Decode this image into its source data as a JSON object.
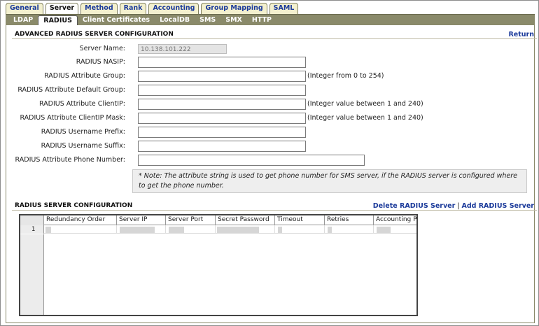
{
  "top_tabs": [
    "General",
    "Server",
    "Method",
    "Rank",
    "Accounting",
    "Group Mapping",
    "SAML"
  ],
  "sub_tabs": [
    "LDAP",
    "RADIUS",
    "Client Certificates",
    "LocalDB",
    "SMS",
    "SMX",
    "HTTP"
  ],
  "advanced": {
    "title": "ADVANCED RADIUS SERVER CONFIGURATION",
    "return_link": "Return",
    "server_name_label": "Server Name:",
    "server_name_value": "10.138.101.222",
    "fields": [
      {
        "label": "RADIUS NASIP:",
        "hint": ""
      },
      {
        "label": "RADIUS Attribute Group:",
        "hint": "(Integer from 0 to 254)"
      },
      {
        "label": "RADIUS Attribute Default Group:",
        "hint": ""
      },
      {
        "label": "RADIUS Attribute ClientIP:",
        "hint": "(Integer value between 1 and 240)"
      },
      {
        "label": "RADIUS Attribute ClientIP Mask:",
        "hint": "(Integer value between 1 and 240)"
      },
      {
        "label": "RADIUS Username Prefix:",
        "hint": ""
      },
      {
        "label": "RADIUS Username Suffix:",
        "hint": ""
      },
      {
        "label": "RADIUS Attribute Phone Number:",
        "hint": ""
      }
    ],
    "note": "* Note: The attribute string is used to get phone number for SMS server, if the RADIUS server is configured where to get the phone number."
  },
  "servers": {
    "title": "RADIUS SERVER CONFIGURATION",
    "delete_link": "Delete RADIUS Server",
    "separator": "|",
    "add_link": "Add RADIUS Server",
    "columns": [
      "Redundancy Order",
      "Server IP",
      "Server Port",
      "Secret Password",
      "Timeout",
      "Retries",
      "Accounting Po"
    ],
    "rows": [
      {
        "num": "1"
      }
    ]
  }
}
